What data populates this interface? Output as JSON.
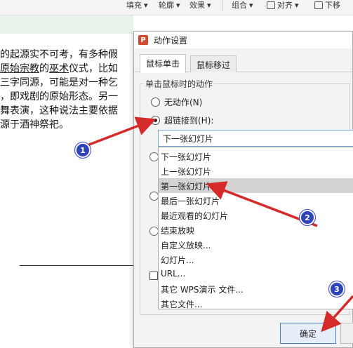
{
  "ribbon": {
    "items": [
      {
        "label": "填充",
        "icon": "fill-icon"
      },
      {
        "label": "轮廓",
        "icon": "outline-icon"
      },
      {
        "label": "效果",
        "icon": "effect-icon"
      },
      {
        "label": "组合",
        "icon": "group-icon"
      },
      {
        "label": "对齐",
        "icon": "align-icon"
      },
      {
        "label": "下移",
        "icon": "move-down-icon"
      }
    ]
  },
  "document": {
    "lines": [
      {
        "before": "的起源实不可考，有多种假",
        "underline": "",
        "after": ""
      },
      {
        "before": "",
        "underline": "原始宗教",
        "mid": "的",
        "underline2": "巫术",
        "after": "仪式，比如"
      },
      {
        "before": "三字同源，可能是对一种乞",
        "underline": "",
        "after": ""
      },
      {
        "before": "，即戏剧的原始形态。另一",
        "underline": "",
        "after": ""
      },
      {
        "before": "舞表演，这种说法主要依据",
        "underline": "",
        "after": ""
      },
      {
        "before": "源于酒神祭祀。",
        "underline": "",
        "after": ""
      }
    ]
  },
  "dialog": {
    "app_icon_letter": "P",
    "title": "动作设置",
    "tabs": [
      "鼠标单击",
      "鼠标移过"
    ],
    "active_tab": 0,
    "group_label": "单击鼠标时的动作",
    "radio_none": "无动作(N)",
    "radio_hyperlink": "超链接到(H):",
    "selected_value": "下一张幻灯片",
    "dropdown_options": [
      "下一张幻灯片",
      "上一张幻灯片",
      "第一张幻灯片",
      "最后一张幻灯片",
      "最近观看的幻灯片",
      "结束放映",
      "自定义放映...",
      "幻灯片...",
      "URL...",
      "其它 WPS演示 文件...",
      "其它文件..."
    ],
    "highlighted_option": "第一张幻灯片",
    "ok_label": "确定"
  },
  "annotations": {
    "badges": [
      "1",
      "2",
      "3"
    ],
    "arrow_color": "#d42a2a",
    "badge_color": "#2f43b8"
  }
}
